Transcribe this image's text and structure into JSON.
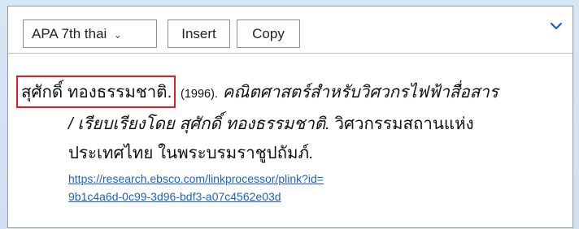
{
  "toolbar": {
    "style_select_value": "APA 7th thai",
    "insert_label": "Insert",
    "copy_label": "Copy"
  },
  "citation": {
    "author": "สุศักดิ์ ทองธรรมชาติ",
    "author_period": ".",
    "year": "(1996).",
    "title_line1": "คณิตศาสตร์สำหรับวิศวกรไฟฟ้าสื่อสาร",
    "title_line2": "/ เรียบเรียงโดย สุศักดิ์ ทองธรรมชาติ.",
    "publisher_line2": "วิศวกรรมสถานแห่ง",
    "publisher_line3_plain": "ประเทศไทย ในพระบรมราชูปถัมภ์",
    "publisher_line3_ital": ".",
    "link_line1": "https://research.ebsco.com/linkprocessor/plink?id=",
    "link_line2": "9b1c4a6d-0c99-3d96-bdf3-a07c4562e03d"
  },
  "icons": {
    "select_caret": "chevron-down-icon",
    "collapse": "chevron-down-icon"
  },
  "colors": {
    "highlight_border": "#e0201c",
    "link": "#1a62c7",
    "collapse_icon": "#1a62c7"
  }
}
